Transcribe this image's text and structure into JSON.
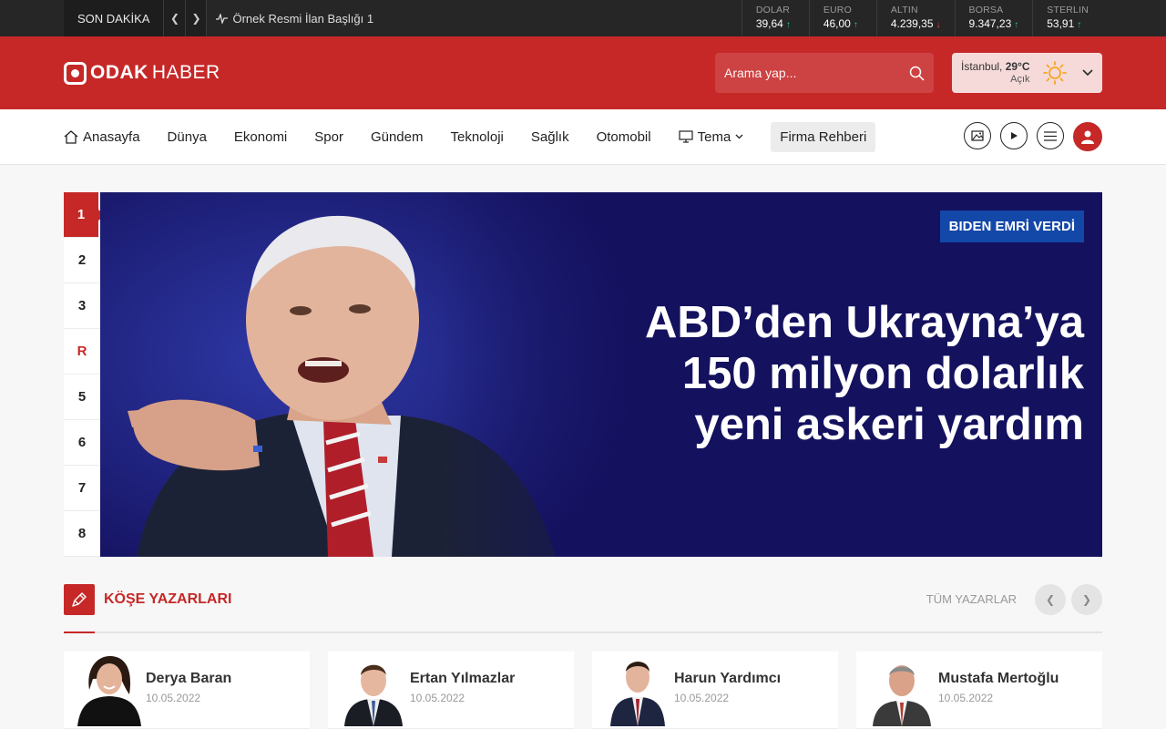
{
  "ticker": {
    "label": "SON DAKİKA",
    "headline": "Örnek Resmi İlan Başlığı 1",
    "markets": [
      {
        "name": "DOLAR",
        "value": "39,64",
        "trend": "up"
      },
      {
        "name": "EURO",
        "value": "46,00",
        "trend": "up"
      },
      {
        "name": "ALTIN",
        "value": "4.239,35",
        "trend": "down"
      },
      {
        "name": "BORSA",
        "value": "9.347,23",
        "trend": "up"
      },
      {
        "name": "STERLIN",
        "value": "53,91",
        "trend": "up"
      }
    ]
  },
  "header": {
    "logo_bold": "ODAK",
    "logo_thin": "HABER",
    "search_placeholder": "Arama yap...",
    "weather": {
      "city": "İstanbul,",
      "temp": "29°C",
      "condition": "Açık"
    }
  },
  "nav": {
    "items": [
      "Anasayfa",
      "Dünya",
      "Ekonomi",
      "Spor",
      "Gündem",
      "Teknoloji",
      "Sağlık",
      "Otomobil",
      "Tema"
    ],
    "firma": "Firma Rehberi"
  },
  "slider": {
    "pages": [
      "1",
      "2",
      "3",
      "R",
      "5",
      "6",
      "7",
      "8"
    ],
    "tag": "BIDEN EMRİ VERDİ",
    "title": "ABD’den Ukrayna’ya 150 milyon dolarlık yeni askeri yardım"
  },
  "columnists": {
    "title": "KÖŞE YAZARLARI",
    "all_link": "TÜM YAZARLAR",
    "authors": [
      {
        "name": "Derya Baran",
        "date": "10.05.2022"
      },
      {
        "name": "Ertan Yılmazlar",
        "date": "10.05.2022"
      },
      {
        "name": "Harun Yardımcı",
        "date": "10.05.2022"
      },
      {
        "name": "Mustafa Mertoğlu",
        "date": "10.05.2022"
      }
    ]
  },
  "colors": {
    "brand_red": "#c62828",
    "hero_bg": "#14115e",
    "tag_blue": "#1347a8"
  }
}
